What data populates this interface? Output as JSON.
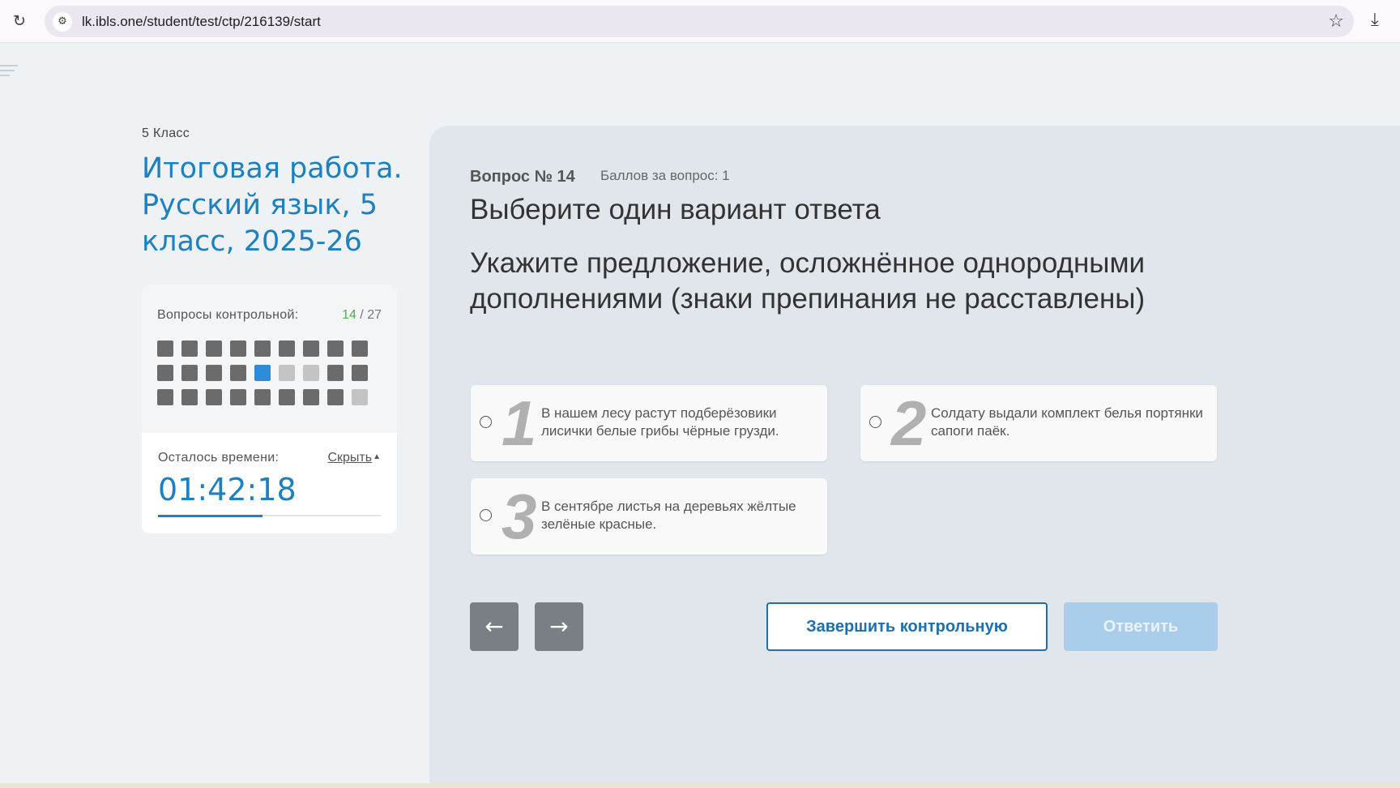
{
  "browser": {
    "url": "lk.ibls.one/student/test/ctp/216139/start",
    "reload_icon": "reload-icon",
    "site_info_icon": "site-settings-icon",
    "bookmark_icon": "star-icon",
    "download_icon": "download-icon"
  },
  "sidebar": {
    "grade": "5 Класс",
    "title": "Итоговая работа. Русский язык, 5 класс, 2025-26"
  },
  "questions_panel": {
    "label": "Вопросы контрольной:",
    "current": "14",
    "separator": " / ",
    "total": "27",
    "cells": [
      "answered",
      "answered",
      "answered",
      "answered",
      "answered",
      "answered",
      "answered",
      "answered",
      "answered",
      "answered",
      "answered",
      "answered",
      "answered",
      "current",
      "empty",
      "empty",
      "answered",
      "answered",
      "answered",
      "answered",
      "answered",
      "answered",
      "answered",
      "answered",
      "answered",
      "answered",
      "empty"
    ]
  },
  "timer": {
    "label": "Осталось времени:",
    "hide_label": "Скрыть",
    "value": "01:42:18",
    "progress": 0.47
  },
  "question": {
    "number_label": "Вопрос № 14",
    "points_label": "Баллов за вопрос: 1",
    "instruction": "Выберите один вариант ответа",
    "text": "Укажите предложение, осложнённое однородными дополнениями (знаки препинания не расставлены)",
    "options": [
      {
        "num": "1",
        "text": "В нашем лесу растут подберёзовики лисички белые грибы чёрные грузди."
      },
      {
        "num": "2",
        "text": "Солдату выдали комплект белья портянки сапоги паёк."
      },
      {
        "num": "3",
        "text": "В сентябре листья на деревьях жёлтые зелёные красные."
      }
    ]
  },
  "controls": {
    "prev": "←",
    "next": "→",
    "finish": "Завершить контрольную",
    "answer": "Ответить"
  }
}
